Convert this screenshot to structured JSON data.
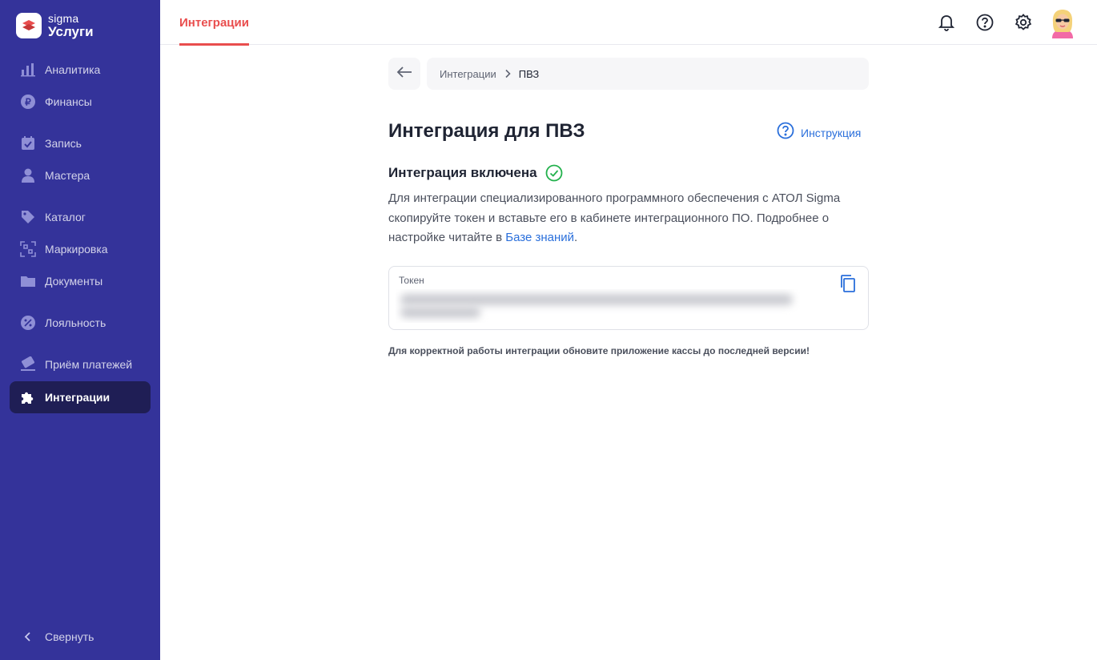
{
  "app": {
    "brand": "sigma",
    "product": "Услуги"
  },
  "colors": {
    "sidebar_bg": "#34339a",
    "sidebar_active_bg": "#1f1e55",
    "accent_red": "#e94e4e",
    "link_blue": "#2a6fdb",
    "success_green": "#22b14c"
  },
  "sidebar": {
    "items": [
      {
        "label": "Аналитика",
        "icon": "bar-chart-icon"
      },
      {
        "label": "Финансы",
        "icon": "ruble-coin-icon"
      },
      {
        "label": "Запись",
        "icon": "calendar-check-icon"
      },
      {
        "label": "Мастера",
        "icon": "person-icon"
      },
      {
        "label": "Каталог",
        "icon": "tag-icon"
      },
      {
        "label": "Маркировка",
        "icon": "qr-scan-icon"
      },
      {
        "label": "Документы",
        "icon": "folder-icon"
      },
      {
        "label": "Лояльность",
        "icon": "discount-badge-icon"
      },
      {
        "label": "Приём платежей",
        "icon": "card-payment-icon"
      },
      {
        "label": "Интеграции",
        "icon": "puzzle-icon",
        "active": true
      }
    ],
    "collapse_label": "Свернуть"
  },
  "header": {
    "tab_label": "Интеграции",
    "icons": [
      "bell-icon",
      "help-icon",
      "gear-icon",
      "avatar"
    ]
  },
  "breadcrumb": {
    "parent": "Интеграции",
    "current": "ПВЗ"
  },
  "page": {
    "title": "Интеграция для ПВЗ",
    "instruction_link": "Инструкция",
    "status_title": "Интеграция включена",
    "description_1": "Для интеграции специализированного программного обеспечения с АТОЛ Sigma скопируйте токен и вставьте его в кабинете интеграционного ПО. Подробнее о настройке читайте в ",
    "knowledge_base_link": "Базе знаний",
    "description_end": ".",
    "token_label": "Токен",
    "note": "Для корректной работы интеграции обновите приложение кассы до последней версии!"
  }
}
